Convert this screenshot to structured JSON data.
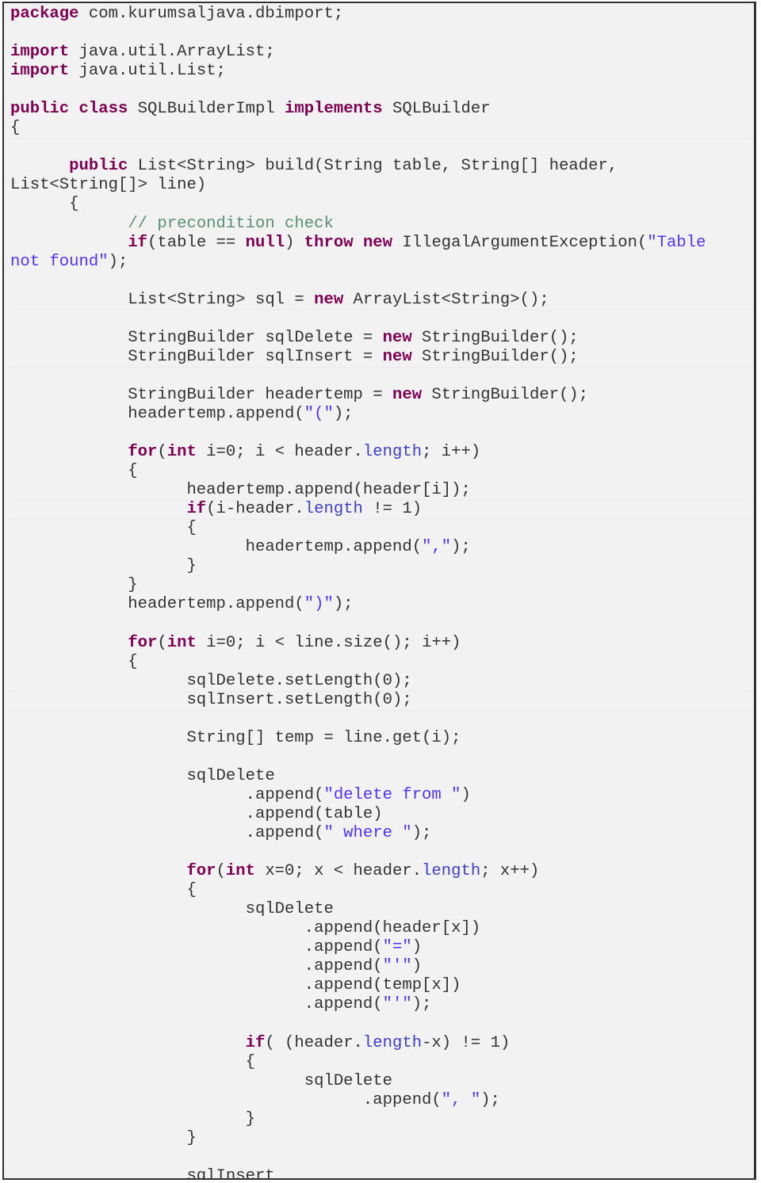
{
  "document": {
    "language": "java",
    "lines": [
      [
        [
          "kw",
          "package"
        ],
        [
          "pl",
          " com.kurumsaljava.dbimport;"
        ]
      ],
      [],
      [
        [
          "kw",
          "import"
        ],
        [
          "pl",
          " java.util.ArrayList;"
        ]
      ],
      [
        [
          "kw",
          "import"
        ],
        [
          "pl",
          " java.util.List;"
        ]
      ],
      [],
      [
        [
          "kw",
          "public"
        ],
        [
          "pl",
          " "
        ],
        [
          "kw",
          "class"
        ],
        [
          "pl",
          " SQLBuilderImpl "
        ],
        [
          "kw",
          "implements"
        ],
        [
          "pl",
          " SQLBuilder"
        ]
      ],
      [
        [
          "pl",
          "{"
        ]
      ],
      [],
      [
        [
          "pl",
          "      "
        ],
        [
          "kw",
          "public"
        ],
        [
          "pl",
          " List<String> build(String table, String[] header,"
        ]
      ],
      [
        [
          "pl",
          "List<String[]> line)"
        ]
      ],
      [
        [
          "pl",
          "      {"
        ]
      ],
      [
        [
          "pl",
          "            "
        ],
        [
          "cmt",
          "// precondition check"
        ]
      ],
      [
        [
          "pl",
          "            "
        ],
        [
          "kw",
          "if"
        ],
        [
          "pl",
          "(table == "
        ],
        [
          "kw",
          "null"
        ],
        [
          "pl",
          ") "
        ],
        [
          "kw",
          "throw"
        ],
        [
          "pl",
          " "
        ],
        [
          "kw",
          "new"
        ],
        [
          "pl",
          " IllegalArgumentException("
        ],
        [
          "str",
          "\"Table"
        ]
      ],
      [
        [
          "str",
          "not found\""
        ],
        [
          "pl",
          ");"
        ]
      ],
      [],
      [
        [
          "pl",
          "            List<String> sql = "
        ],
        [
          "kw",
          "new"
        ],
        [
          "pl",
          " ArrayList<String>();"
        ]
      ],
      [],
      [
        [
          "pl",
          "            StringBuilder sqlDelete = "
        ],
        [
          "kw",
          "new"
        ],
        [
          "pl",
          " StringBuilder();"
        ]
      ],
      [
        [
          "pl",
          "            StringBuilder sqlInsert = "
        ],
        [
          "kw",
          "new"
        ],
        [
          "pl",
          " StringBuilder();"
        ]
      ],
      [],
      [
        [
          "pl",
          "            StringBuilder headertemp = "
        ],
        [
          "kw",
          "new"
        ],
        [
          "pl",
          " StringBuilder();"
        ]
      ],
      [
        [
          "pl",
          "            headertemp.append("
        ],
        [
          "str",
          "\"(\""
        ],
        [
          "pl",
          ");"
        ]
      ],
      [],
      [
        [
          "pl",
          "            "
        ],
        [
          "kw",
          "for"
        ],
        [
          "pl",
          "("
        ],
        [
          "kw",
          "int"
        ],
        [
          "pl",
          " i=0; i < header."
        ],
        [
          "fld",
          "length"
        ],
        [
          "pl",
          "; i++)"
        ]
      ],
      [
        [
          "pl",
          "            {"
        ]
      ],
      [
        [
          "pl",
          "                  headertemp.append(header[i]);"
        ]
      ],
      [
        [
          "pl",
          "                  "
        ],
        [
          "kw",
          "if"
        ],
        [
          "pl",
          "(i-header."
        ],
        [
          "fld",
          "length"
        ],
        [
          "pl",
          " != 1)"
        ]
      ],
      [
        [
          "pl",
          "                  {"
        ]
      ],
      [
        [
          "pl",
          "                        headertemp.append("
        ],
        [
          "str",
          "\",\""
        ],
        [
          "pl",
          ");"
        ]
      ],
      [
        [
          "pl",
          "                  }"
        ]
      ],
      [
        [
          "pl",
          "            }"
        ]
      ],
      [
        [
          "pl",
          "            headertemp.append("
        ],
        [
          "str",
          "\")\""
        ],
        [
          "pl",
          ");"
        ]
      ],
      [],
      [
        [
          "pl",
          "            "
        ],
        [
          "kw",
          "for"
        ],
        [
          "pl",
          "("
        ],
        [
          "kw",
          "int"
        ],
        [
          "pl",
          " i=0; i < line.size(); i++)"
        ]
      ],
      [
        [
          "pl",
          "            {"
        ]
      ],
      [
        [
          "pl",
          "                  sqlDelete.setLength(0);"
        ]
      ],
      [
        [
          "pl",
          "                  sqlInsert.setLength(0);"
        ]
      ],
      [],
      [
        [
          "pl",
          "                  String[] temp = line.get(i);"
        ]
      ],
      [],
      [
        [
          "pl",
          "                  sqlDelete"
        ]
      ],
      [
        [
          "pl",
          "                        .append("
        ],
        [
          "str",
          "\"delete from \""
        ],
        [
          "pl",
          ")"
        ]
      ],
      [
        [
          "pl",
          "                        .append(table)"
        ]
      ],
      [
        [
          "pl",
          "                        .append("
        ],
        [
          "str",
          "\" where \""
        ],
        [
          "pl",
          ");"
        ]
      ],
      [],
      [
        [
          "pl",
          "                  "
        ],
        [
          "kw",
          "for"
        ],
        [
          "pl",
          "("
        ],
        [
          "kw",
          "int"
        ],
        [
          "pl",
          " x=0; x < header."
        ],
        [
          "fld",
          "length"
        ],
        [
          "pl",
          "; x++)"
        ]
      ],
      [
        [
          "pl",
          "                  {"
        ]
      ],
      [
        [
          "pl",
          "                        sqlDelete"
        ]
      ],
      [
        [
          "pl",
          "                              .append(header[x])"
        ]
      ],
      [
        [
          "pl",
          "                              .append("
        ],
        [
          "str",
          "\"=\""
        ],
        [
          "pl",
          ")"
        ]
      ],
      [
        [
          "pl",
          "                              .append("
        ],
        [
          "str",
          "\"'\""
        ],
        [
          "pl",
          ")"
        ]
      ],
      [
        [
          "pl",
          "                              .append(temp[x])"
        ]
      ],
      [
        [
          "pl",
          "                              .append("
        ],
        [
          "str",
          "\"'\""
        ],
        [
          "pl",
          ");"
        ]
      ],
      [],
      [
        [
          "pl",
          "                        "
        ],
        [
          "kw",
          "if"
        ],
        [
          "pl",
          "( (header."
        ],
        [
          "fld",
          "length"
        ],
        [
          "pl",
          "-x) != 1)"
        ]
      ],
      [
        [
          "pl",
          "                        {"
        ]
      ],
      [
        [
          "pl",
          "                              sqlDelete"
        ]
      ],
      [
        [
          "pl",
          "                                    .append("
        ],
        [
          "str",
          "\", \""
        ],
        [
          "pl",
          ");"
        ]
      ],
      [
        [
          "pl",
          "                        }"
        ]
      ],
      [
        [
          "pl",
          "                  }"
        ]
      ],
      [],
      [
        [
          "pl",
          "                  sqlInsert"
        ]
      ]
    ]
  }
}
